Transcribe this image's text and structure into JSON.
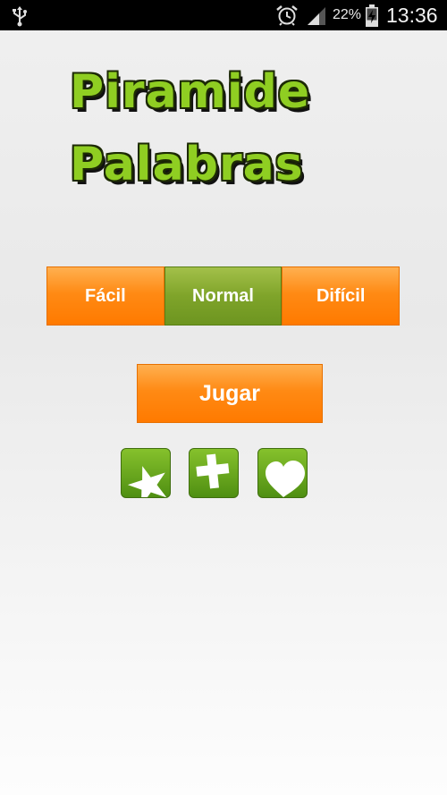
{
  "status_bar": {
    "battery_percent": "22%",
    "time": "13:36",
    "icons": [
      "usb-icon",
      "alarm-icon",
      "signal-icon",
      "battery-charging-icon"
    ]
  },
  "title": {
    "line1": "Piramide",
    "line2": "Palabras",
    "color": "#8fce22"
  },
  "difficulty": {
    "options": [
      "Fácil",
      "Normal",
      "Difícil"
    ],
    "selected": "Normal"
  },
  "play_button": {
    "label": "Jugar"
  },
  "icon_buttons": [
    "star-icon",
    "plus-icon",
    "heart-icon"
  ],
  "colors": {
    "orange": "#ff8a14",
    "green": "#7fa42a"
  }
}
